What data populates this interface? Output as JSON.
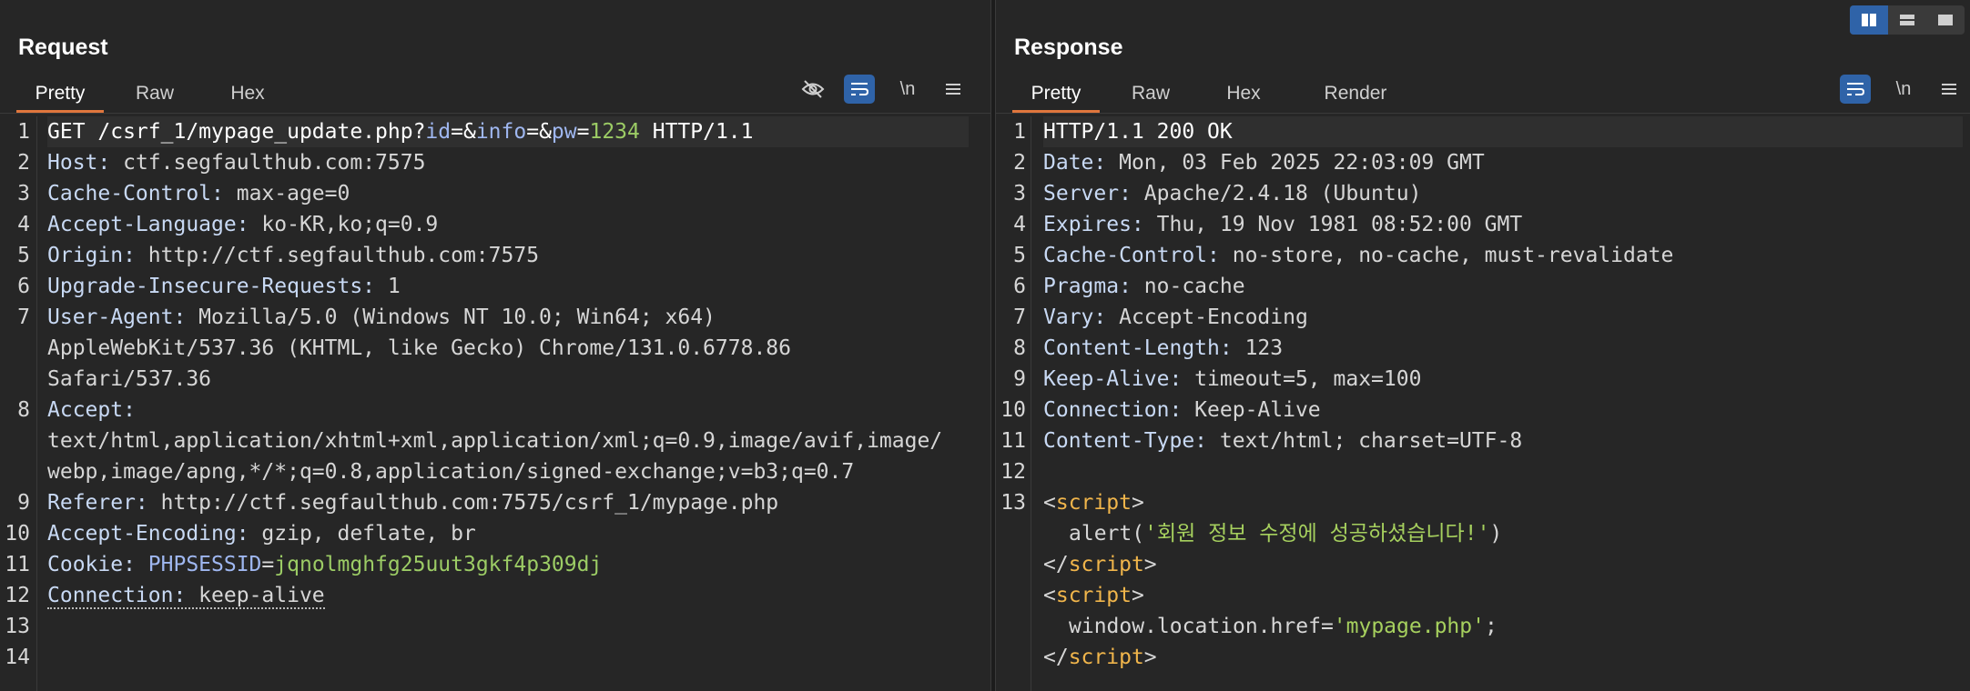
{
  "layout_buttons": [
    "split-horizontal-icon",
    "split-vertical-icon",
    "single-pane-icon"
  ],
  "request": {
    "title": "Request",
    "tabs": [
      "Pretty",
      "Raw",
      "Hex"
    ],
    "active_tab": "Pretty",
    "tools": {
      "newline": "\\n"
    },
    "lines": {
      "l1": {
        "method": "GET /csrf_1/mypage_update.php?",
        "p1": "id",
        "eq1": "=&",
        "p2": "info",
        "eq2": "=&",
        "p3": "pw",
        "eq3": "=",
        "v3": "1234",
        "rest": " HTTP/1.1"
      },
      "l2": {
        "k": "Host:",
        "v": " ctf.segfaulthub.com:7575"
      },
      "l3": {
        "k": "Cache-Control:",
        "v": " max-age=0"
      },
      "l4": {
        "k": "Accept-Language:",
        "v": " ko-KR,ko;q=0.9"
      },
      "l5": {
        "k": "Origin:",
        "v": " http://ctf.segfaulthub.com:7575"
      },
      "l6": {
        "k": "Upgrade-Insecure-Requests:",
        "v": " 1"
      },
      "l7": {
        "k": "User-Agent:",
        "v": " Mozilla/5.0 (Windows NT 10.0; Win64; x64)",
        "v2": "AppleWebKit/537.36 (KHTML, like Gecko) Chrome/131.0.6778.86",
        "v3": "Safari/537.36"
      },
      "l8": {
        "k": "Accept:",
        "v2": "text/html,application/xhtml+xml,application/xml;q=0.9,image/avif,image/",
        "v3": "webp,image/apng,*/*;q=0.8,application/signed-exchange;v=b3;q=0.7"
      },
      "l9": {
        "k": "Referer:",
        "v": " http://ctf.segfaulthub.com:7575/csrf_1/mypage.php"
      },
      "l10": {
        "k": "Accept-Encoding:",
        "v": " gzip, deflate, br"
      },
      "l11": {
        "k": "Cookie:",
        "ck": " PHPSESSID",
        "eq": "=",
        "cv": "jqnolmghfg25uut3gkf4p309dj"
      },
      "l12": {
        "k": "Connection:",
        "v": " keep-alive"
      }
    },
    "line_numbers": [
      "1",
      "2",
      "3",
      "4",
      "5",
      "6",
      "7",
      "8",
      "9",
      "10",
      "11",
      "12",
      "13",
      "14"
    ]
  },
  "response": {
    "title": "Response",
    "tabs": [
      "Pretty",
      "Raw",
      "Hex",
      "Render"
    ],
    "active_tab": "Pretty",
    "tools": {
      "newline": "\\n"
    },
    "lines": {
      "l1": "HTTP/1.1 200 OK",
      "l2": {
        "k": "Date:",
        "v": " Mon, 03 Feb 2025 22:03:09 GMT"
      },
      "l3": {
        "k": "Server:",
        "v": " Apache/2.4.18 (Ubuntu)"
      },
      "l4": {
        "k": "Expires:",
        "v": " Thu, 19 Nov 1981 08:52:00 GMT"
      },
      "l5": {
        "k": "Cache-Control:",
        "v": " no-store, no-cache, must-revalidate"
      },
      "l6": {
        "k": "Pragma:",
        "v": " no-cache"
      },
      "l7": {
        "k": "Vary:",
        "v": " Accept-Encoding"
      },
      "l8": {
        "k": "Content-Length:",
        "v": " 123"
      },
      "l9": {
        "k": "Keep-Alive:",
        "v": " timeout=5, max=100"
      },
      "l10": {
        "k": "Connection:",
        "v": " Keep-Alive"
      },
      "l11": {
        "k": "Content-Type:",
        "v": " text/html; charset=UTF-8"
      },
      "s_open_lt": "<",
      "s_tag": "script",
      "s_gt": ">",
      "s_close_lt": "</",
      "alert_fn": "alert(",
      "alert_str": "'회원 정보 수정에 성공하셨습니다!'",
      "alert_end": ")",
      "loc_fn": "window.location.href=",
      "loc_str": "'mypage.php'",
      "loc_end": ";"
    },
    "line_numbers": [
      "1",
      "2",
      "3",
      "4",
      "5",
      "6",
      "7",
      "8",
      "9",
      "10",
      "11",
      "12",
      "13"
    ]
  }
}
